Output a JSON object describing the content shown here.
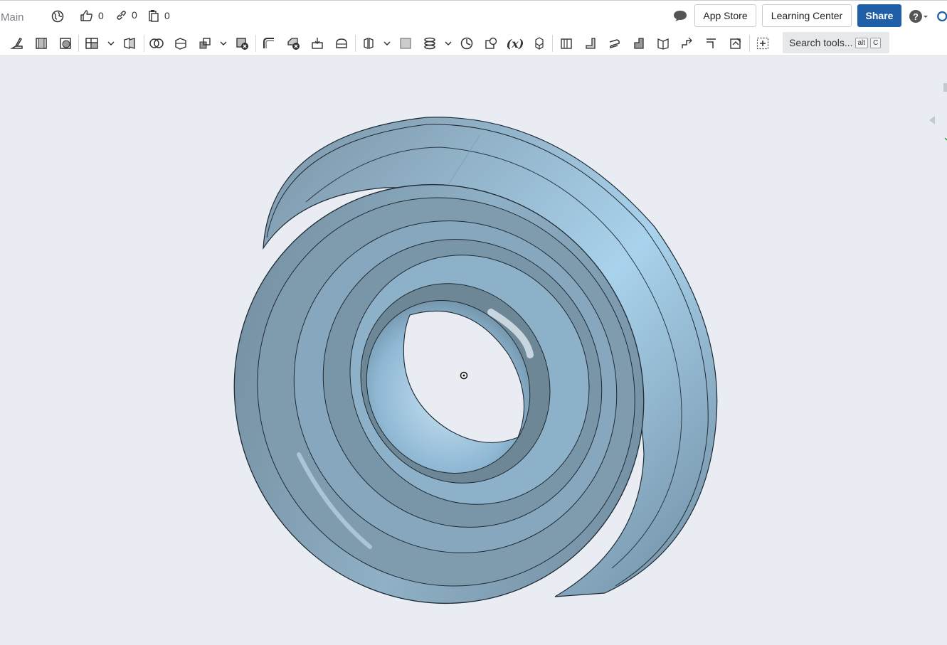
{
  "header": {
    "document_title": "Main",
    "likes_count": "0",
    "links_count": "0",
    "copies_count": "0",
    "app_store_label": "App Store",
    "learning_center_label": "Learning Center",
    "share_label": "Share",
    "help_icon_glyph": "?"
  },
  "toolbar": {
    "search_placeholder": "Search tools...",
    "search_key_1": "alt",
    "search_key_2": "C",
    "variable_tool_glyph": "(x)"
  },
  "icons": [
    "globe-icon",
    "thumbs-up-icon",
    "link-icon",
    "clipboard-icon",
    "comment-icon",
    "help-icon"
  ],
  "colors": {
    "accent": "#1f5fa8",
    "viewport_bg": "#e9edf3",
    "part_face": "#8fb3cc",
    "part_edge": "#1e2a33"
  }
}
